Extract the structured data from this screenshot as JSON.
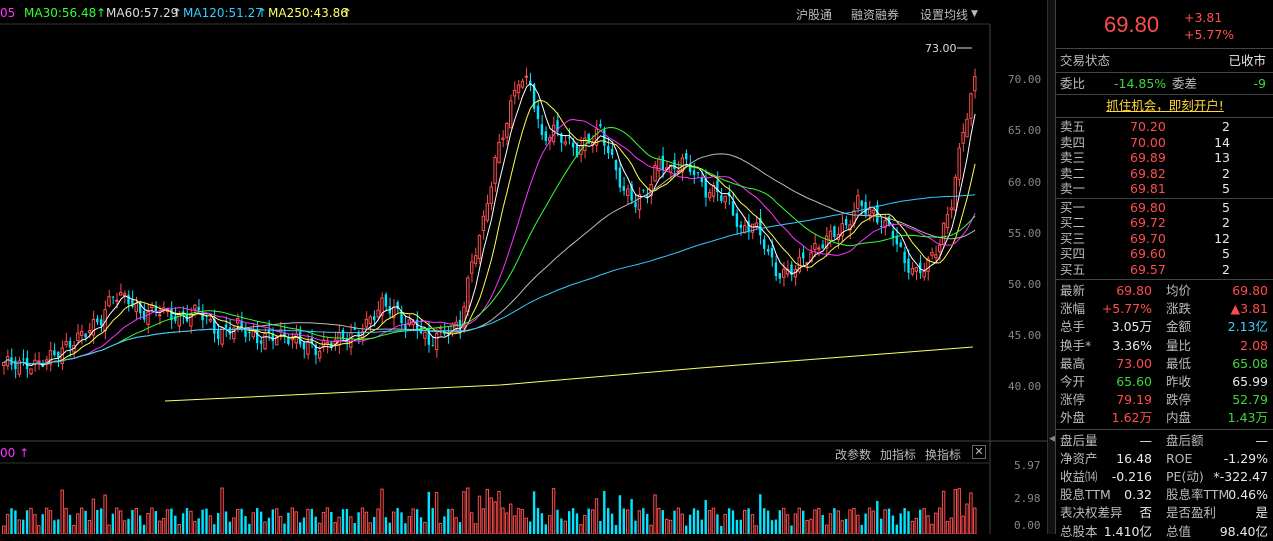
{
  "ma_legend": {
    "ma5": "05",
    "ma30": "MA30:56.48",
    "ma60": "MA60:57.29",
    "ma120": "MA120:51.27",
    "ma250": "MA250:43.86"
  },
  "toolbar": {
    "hgt": "沪股通",
    "margin": "融资融券",
    "settings": "设置均线"
  },
  "price_axis": [
    "70.00",
    "65.00",
    "60.00",
    "55.00",
    "50.00",
    "45.00",
    "40.00"
  ],
  "high_marker": "73.00",
  "indicator_bar": {
    "vol_legend": "00",
    "modify": "改参数",
    "add": "加指标",
    "switch": "换指标"
  },
  "volume_axis": [
    "5.97",
    "2.98",
    "0.00"
  ],
  "colors": {
    "up": "#ff4d4d",
    "down": "#00e5ff",
    "ma5": "#ffffff",
    "ma10": "#ffff4d",
    "ma20": "#ff33ff",
    "ma30": "#33ff33",
    "ma60": "#bbbbbb",
    "ma120": "#33ccff",
    "ma250": "#ffff66"
  },
  "quote": {
    "price": "69.80",
    "change": "+3.81",
    "change_pct": "+5.77%",
    "status_label": "交易状态",
    "status_value": "已收市",
    "wb_label": "委比",
    "wb_value": "-14.85%",
    "wc_label": "委差",
    "wc_value": "-9",
    "promo": "抓住机会，即刻开户!",
    "asks": [
      {
        "label": "卖五",
        "price": "70.20",
        "vol": "2"
      },
      {
        "label": "卖四",
        "price": "70.00",
        "vol": "14"
      },
      {
        "label": "卖三",
        "price": "69.89",
        "vol": "13"
      },
      {
        "label": "卖二",
        "price": "69.82",
        "vol": "2"
      },
      {
        "label": "卖一",
        "price": "69.81",
        "vol": "5"
      }
    ],
    "bids": [
      {
        "label": "买一",
        "price": "69.80",
        "vol": "5"
      },
      {
        "label": "买二",
        "price": "69.72",
        "vol": "2"
      },
      {
        "label": "买三",
        "price": "69.70",
        "vol": "12"
      },
      {
        "label": "买四",
        "price": "69.60",
        "vol": "5"
      },
      {
        "label": "买五",
        "price": "69.57",
        "vol": "2"
      }
    ],
    "stats": [
      {
        "l1": "最新",
        "v1": "69.80",
        "c1": "red",
        "l2": "均价",
        "v2": "69.80",
        "c2": "red"
      },
      {
        "l1": "涨幅",
        "v1": "+5.77%",
        "c1": "red",
        "l2": "涨跌",
        "v2": "▲3.81",
        "c2": "red"
      },
      {
        "l1": "总手",
        "v1": "3.05万",
        "c1": "white",
        "l2": "金额",
        "v2": "2.13亿",
        "c2": "cyan"
      },
      {
        "l1": "换手*",
        "v1": "3.36%",
        "c1": "white",
        "l2": "量比",
        "v2": "2.08",
        "c2": "red"
      },
      {
        "l1": "最高",
        "v1": "73.00",
        "c1": "red",
        "l2": "最低",
        "v2": "65.08",
        "c2": "green"
      },
      {
        "l1": "今开",
        "v1": "65.60",
        "c1": "green",
        "l2": "昨收",
        "v2": "65.99",
        "c2": "white"
      },
      {
        "l1": "涨停",
        "v1": "79.19",
        "c1": "red",
        "l2": "跌停",
        "v2": "52.79",
        "c2": "green"
      },
      {
        "l1": "外盘",
        "v1": "1.62万",
        "c1": "red",
        "l2": "内盘",
        "v2": "1.43万",
        "c2": "green"
      }
    ],
    "after": [
      {
        "l1": "盘后量",
        "v1": "—",
        "c1": "white",
        "l2": "盘后额",
        "v2": "—",
        "c2": "white"
      },
      {
        "l1": "净资产",
        "v1": "16.48",
        "c1": "white",
        "l2": "ROE",
        "v2": "-1.29%",
        "c2": "white"
      },
      {
        "l1": "收益⒁",
        "v1": "-0.216",
        "c1": "white",
        "l2": "PE(动)",
        "v2": "*-322.47",
        "c2": "white"
      },
      {
        "l1": "股息TTM",
        "v1": "0.32",
        "c1": "white",
        "l2": "股息率TTM",
        "v2": "0.46%",
        "c2": "white"
      },
      {
        "l1": "表决权差异",
        "v1": "否",
        "c1": "white",
        "l2": "是否盈利",
        "v2": "是",
        "c2": "white"
      },
      {
        "l1": "总股本",
        "v1": "1.410亿",
        "c1": "white",
        "l2": "总值",
        "v2": "98.40亿",
        "c2": "white"
      }
    ]
  }
}
